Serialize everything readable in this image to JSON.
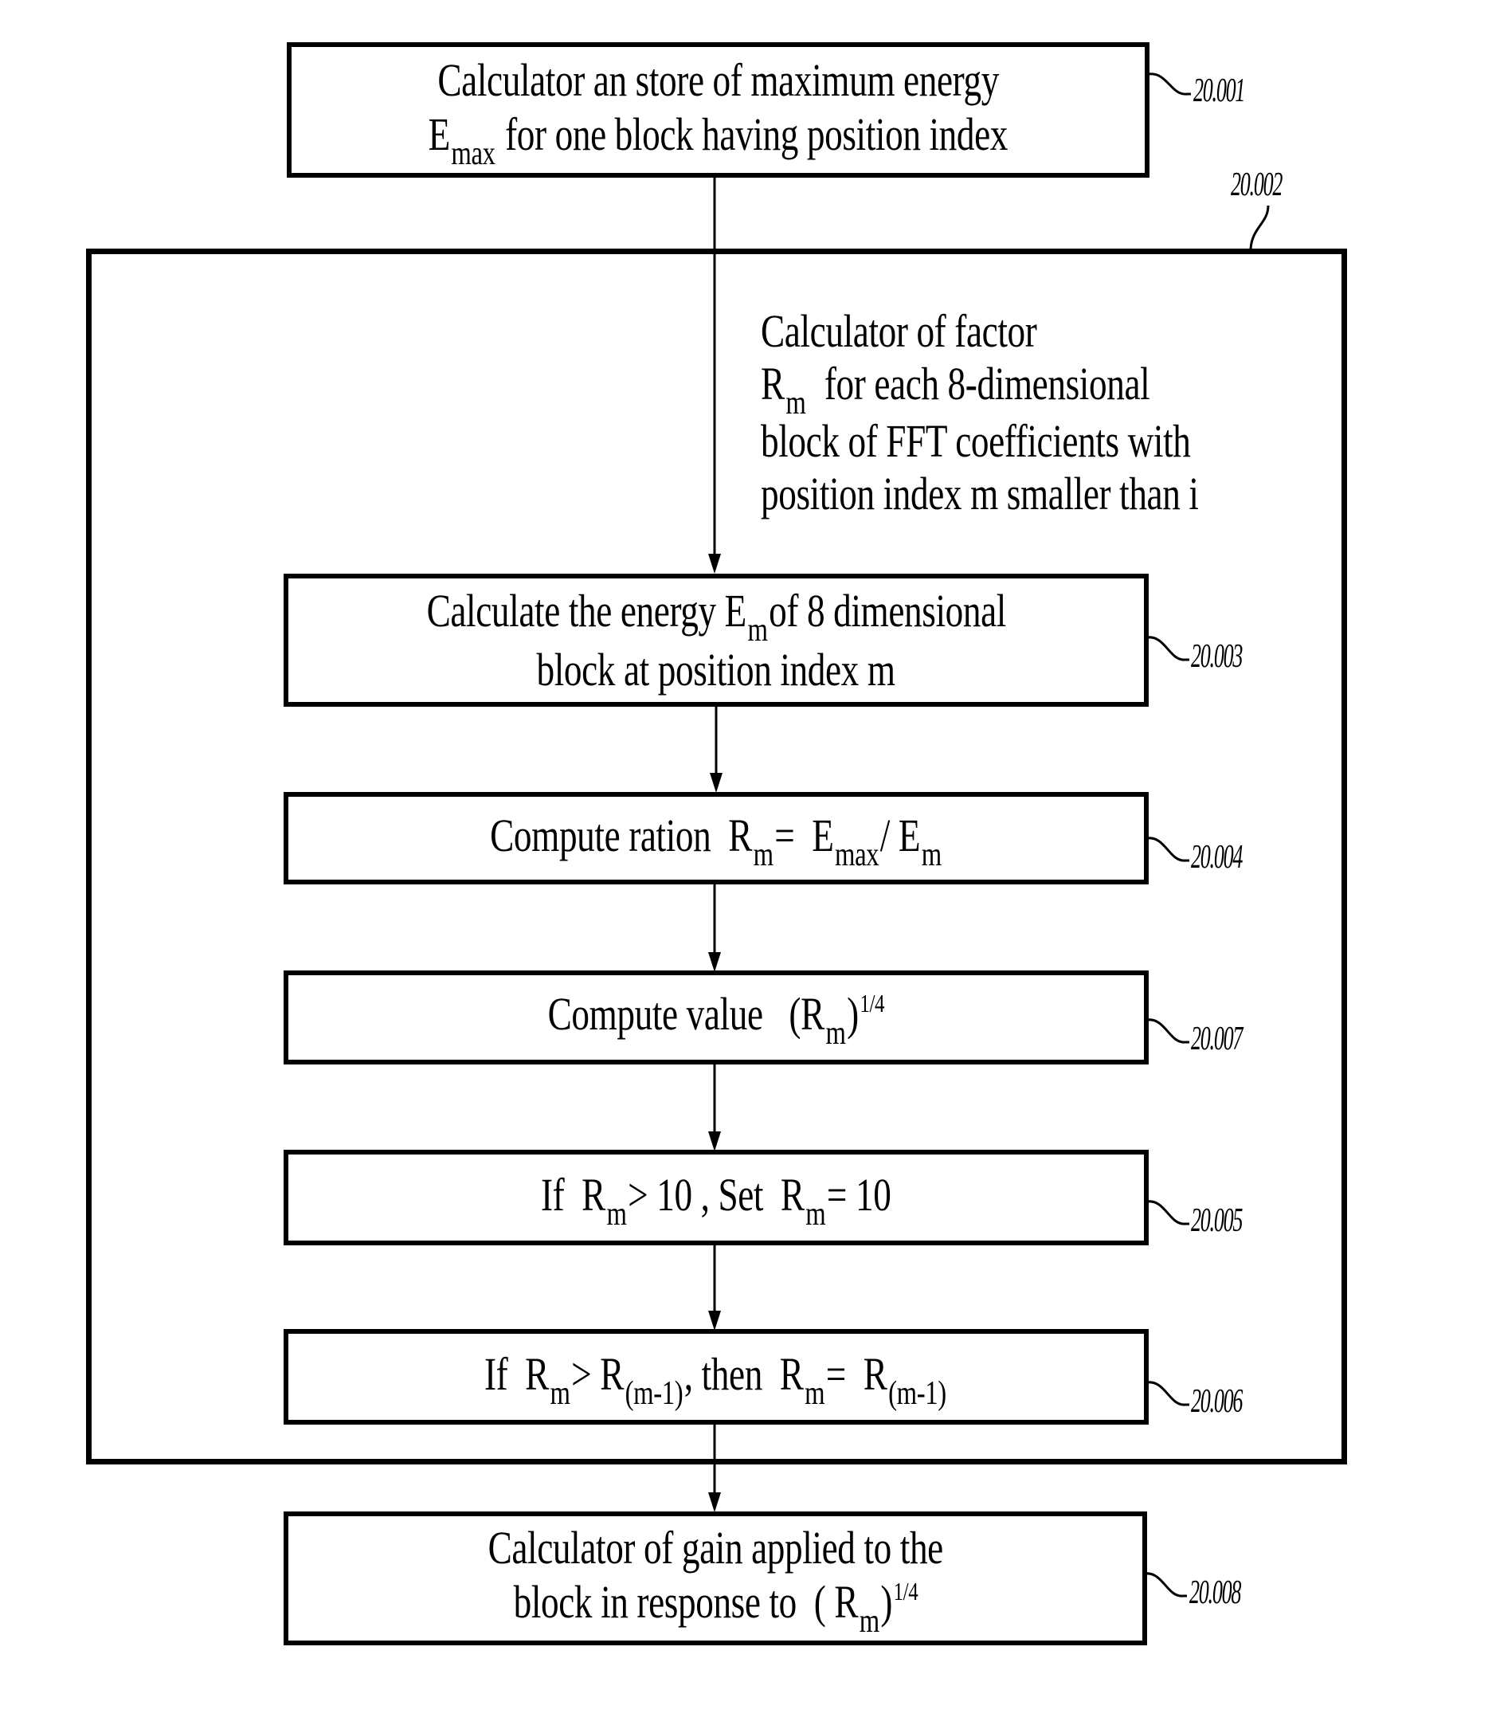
{
  "diagram": {
    "type": "flowchart",
    "colors": {
      "line": "#000000",
      "background": "#ffffff"
    },
    "steps": [
      {
        "ref": "20.001",
        "lines": [
          [
            {
              "t": "Calculator an store of maximum energy"
            }
          ],
          [
            {
              "t": "E"
            },
            {
              "sub": "max"
            },
            {
              "t": " for one block having position index"
            }
          ]
        ]
      },
      {
        "ref": "20.003",
        "lines": [
          [
            {
              "t": "Calculate the energy E"
            },
            {
              "sub": "m"
            },
            {
              "t": "of 8 dimensional"
            }
          ],
          [
            {
              "t": "block at position index m"
            }
          ]
        ]
      },
      {
        "ref": "20.004",
        "lines": [
          [
            {
              "t": "Compute ration  R"
            },
            {
              "sub": "m"
            },
            {
              "t": "=  E"
            },
            {
              "sub": "max"
            },
            {
              "t": "/ E"
            },
            {
              "sub": "m"
            }
          ]
        ]
      },
      {
        "ref": "20.007",
        "lines": [
          [
            {
              "t": "Compute value   (R"
            },
            {
              "sub": "m"
            },
            {
              "t": ")"
            },
            {
              "sup": "1/4"
            }
          ]
        ]
      },
      {
        "ref": "20.005",
        "lines": [
          [
            {
              "t": "If  R"
            },
            {
              "sub": "m"
            },
            {
              "t": "> 10 , Set  R"
            },
            {
              "sub": "m"
            },
            {
              "t": "= 10"
            }
          ]
        ]
      },
      {
        "ref": "20.006",
        "lines": [
          [
            {
              "t": "If  R"
            },
            {
              "sub": "m"
            },
            {
              "t": "> R"
            },
            {
              "sub": "(m-1)"
            },
            {
              "t": ", then  R"
            },
            {
              "sub": "m"
            },
            {
              "t": "=  R"
            },
            {
              "sub": "(m-1)"
            }
          ]
        ]
      },
      {
        "ref": "20.008",
        "lines": [
          [
            {
              "t": "Calculator of gain applied to the"
            }
          ],
          [
            {
              "t": "block in response to  ( R"
            },
            {
              "sub": "m"
            },
            {
              "t": ")"
            },
            {
              "sup": "1/4"
            }
          ]
        ]
      }
    ],
    "group": {
      "ref": "20.002",
      "label_lines": [
        [
          {
            "t": "Calculator of factor"
          }
        ],
        [
          {
            "t": "R"
          },
          {
            "sub": "m"
          },
          {
            "t": "  for each 8-dimensional"
          }
        ],
        [
          {
            "t": "block of FFT coefficients with"
          }
        ],
        [
          {
            "t": "position index m smaller than i"
          }
        ]
      ]
    }
  }
}
